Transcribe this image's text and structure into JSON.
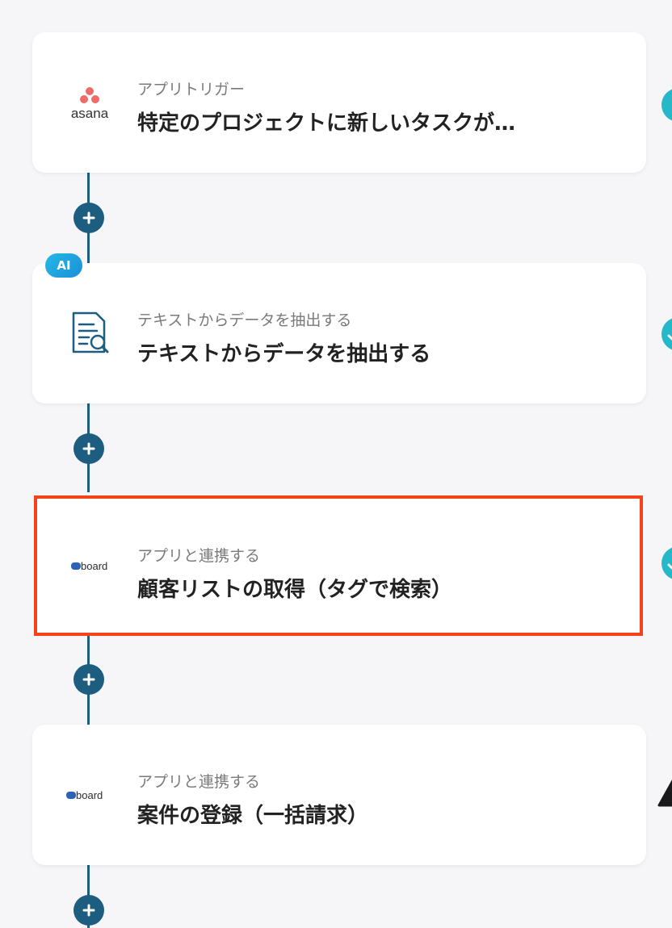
{
  "flow": {
    "steps": [
      {
        "subtitle": "アプリトリガー",
        "title": "特定のプロジェクトに新しいタスクが…",
        "logo": "asana",
        "logo_text": "asana"
      },
      {
        "subtitle": "テキストからデータを抽出する",
        "title": "テキストからデータを抽出する",
        "logo": "document-search-icon",
        "badge": "AI"
      },
      {
        "subtitle": "アプリと連携する",
        "title": "顧客リストの取得（タグで検索）",
        "logo": "board",
        "logo_text": "board",
        "selected": true
      },
      {
        "subtitle": "アプリと連携する",
        "title": "案件の登録（一括請求）",
        "logo": "board",
        "logo_text": "board"
      }
    ]
  },
  "colors": {
    "background": "#f6f6f8",
    "connector": "#1d5d80",
    "selection": "#f5421a",
    "ai_badge": "#25b8e6",
    "asana": "#f06a6a"
  }
}
